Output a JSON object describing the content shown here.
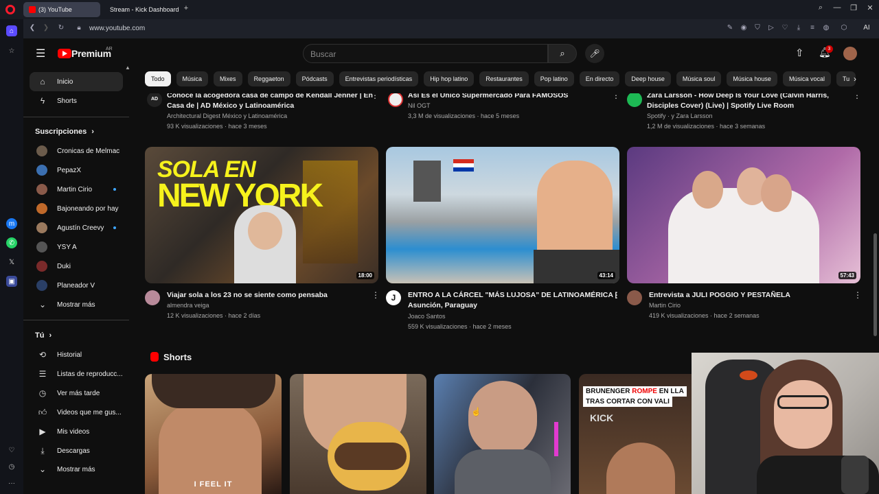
{
  "browser": {
    "tabs": [
      {
        "title": "(3) YouTube"
      },
      {
        "title": "Stream - Kick Dashboard"
      }
    ],
    "new_tab": "+",
    "url": "www.youtube.com"
  },
  "header": {
    "logo_text": "Premium",
    "logo_badge": "AR",
    "search_placeholder": "Buscar",
    "notif_count": "3"
  },
  "sidebar": {
    "items": [
      {
        "label": "Inicio"
      },
      {
        "label": "Shorts"
      }
    ],
    "subs_heading": "Suscripciones",
    "subs": [
      {
        "label": "Cronicas de Melmac",
        "color": "#6b5b4b",
        "dot": false
      },
      {
        "label": "PepazX",
        "color": "#3b6fb0",
        "dot": false
      },
      {
        "label": "Martin Cirio",
        "color": "#8a5a4a",
        "dot": true
      },
      {
        "label": "Bajoneando por hay",
        "color": "#c0692a",
        "dot": false
      },
      {
        "label": "Agustín Creevy",
        "color": "#9b7a5e",
        "dot": true
      },
      {
        "label": "YSY A",
        "color": "#555",
        "dot": false
      },
      {
        "label": "Duki",
        "color": "#7a2a2a",
        "dot": false
      },
      {
        "label": "Planeador V",
        "color": "#2a3f66",
        "dot": false
      }
    ],
    "show_more": "Mostrar más",
    "you_heading": "Tú",
    "you_items": [
      {
        "label": "Historial",
        "icon": "history-icon"
      },
      {
        "label": "Listas de reproducc...",
        "icon": "playlists-icon"
      },
      {
        "label": "Ver más tarde",
        "icon": "clock-icon"
      },
      {
        "label": "Videos que me gus...",
        "icon": "thumbs-up-icon"
      },
      {
        "label": "Mis videos",
        "icon": "play-square-icon"
      },
      {
        "label": "Descargas",
        "icon": "download-icon"
      }
    ],
    "show_more_2": "Mostrar más"
  },
  "chips": [
    "Todo",
    "Música",
    "Mixes",
    "Reggaeton",
    "Pódcasts",
    "Entrevistas periodísticas",
    "Hip hop latino",
    "Restaurantes",
    "Pop latino",
    "En directo",
    "Deep house",
    "Música soul",
    "Música house",
    "Música vocal",
    "Tu"
  ],
  "top_row": [
    {
      "title": "Conoce la acogedora casa de campo de Kendall Jenner | En Casa de | AD México y Latinoamérica",
      "channel": "Architectural Digest México y Latinoamérica",
      "meta": "93 K visualizaciones · hace 3 meses",
      "avatar": "#222",
      "avtext": "AD"
    },
    {
      "title": "Así Es el Único Supermercado Para FAMOSOS",
      "channel": "Nil OGT",
      "meta": "3,3 M de visualizaciones · hace 5 meses",
      "avatar": "#eee",
      "avtext": ""
    },
    {
      "title": "Zara Larsson - How Deep Is Your Love (Calvin Harris, Disciples Cover) (Live) | Spotify Live Room",
      "channel": "Spotify · y Zara Larsson",
      "meta": "1,2 M de visualizaciones · hace 3 semanas",
      "avatar": "#1db954",
      "avtext": ""
    }
  ],
  "videos": [
    {
      "title1": "Viajar sola a los 23 no se siente como pensaba",
      "title2": "",
      "channel": "almendra veiga",
      "meta": "12 K visualizaciones · hace 2 días",
      "duration": "18:00",
      "avatar": "#b88a9a",
      "overlay1": "SOLA EN",
      "overlay2": "NEW YORK"
    },
    {
      "title1": "ENTRO A LA CÁRCEL \"MÁS LUJOSA\" DE LATINOAMÉRICA |",
      "title2": "Asunción, Paraguay",
      "channel": "Joaco Santos",
      "meta": "559 K visualizaciones · hace 2 meses",
      "duration": "43:14",
      "avatar": "#fff",
      "avtext": "J"
    },
    {
      "title1": "Entrevista a JULI POGGIO Y PESTAÑELA",
      "title2": "",
      "channel": "Martin Cirio",
      "meta": "419 K visualizaciones · hace 2 semanas",
      "duration": "57:43",
      "avatar": "#8a5a4a"
    }
  ],
  "shorts": {
    "heading": "Shorts",
    "caption1": "I FEEL IT",
    "caption4a": "BRUNENGER",
    "caption4b": "ROMPE",
    "caption4c": "EN LLA",
    "caption4d": "TRAS CORTAR CON VALI",
    "caption4e": "KICK"
  },
  "colors": {
    "accent": "#ff0000",
    "bg": "#0f0f0f",
    "chip": "#272727"
  }
}
